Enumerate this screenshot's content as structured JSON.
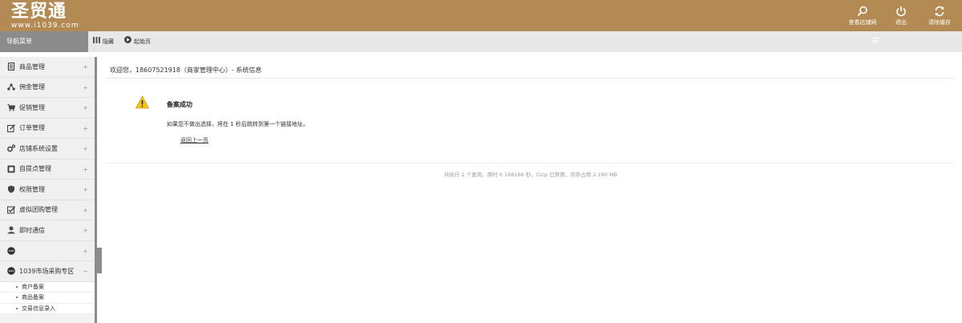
{
  "brand": {
    "name": "圣贸通",
    "url": "www.i1039.com"
  },
  "top_actions": [
    {
      "label": "查看店铺网",
      "icon": "search-icon"
    },
    {
      "label": "退出",
      "icon": "power-icon"
    },
    {
      "label": "清除缓存",
      "icon": "refresh-icon"
    }
  ],
  "subbar": {
    "nav_title": "导航菜单",
    "hide_label": "隐藏",
    "home_label": "起始页"
  },
  "sidebar": {
    "items": [
      {
        "label": "商品管理",
        "icon": "goods-icon",
        "toggle": "+"
      },
      {
        "label": "佣金管理",
        "icon": "share-icon",
        "toggle": "+"
      },
      {
        "label": "促销管理",
        "icon": "cart-icon",
        "toggle": "+"
      },
      {
        "label": "订单管理",
        "icon": "edit-order-icon",
        "toggle": "+"
      },
      {
        "label": "店铺系统设置",
        "icon": "cogs-icon",
        "toggle": "+"
      },
      {
        "label": "自提点管理",
        "icon": "pickup-icon",
        "toggle": "+"
      },
      {
        "label": "权限管理",
        "icon": "shield-icon",
        "toggle": "+"
      },
      {
        "label": "虚拟团购管理",
        "icon": "checkbox-icon",
        "toggle": "+"
      },
      {
        "label": "即时通信",
        "icon": "user-chat-icon",
        "toggle": "+"
      },
      {
        "label": "",
        "icon": "more-icon",
        "toggle": "+"
      },
      {
        "label": "1039市场采购专区",
        "icon": "more-icon",
        "toggle": "−"
      }
    ],
    "sub_items": [
      "商户备案",
      "商品备案",
      "交易信息录入"
    ]
  },
  "main": {
    "breadcrumb": "欢迎您，18607521918（商家管理中心）- 系统信息",
    "message_title": "备案成功",
    "message_text": "如果您不做出选择，将在 1 秒后跳转到第一个链接地址。",
    "back_link": "返回上一页",
    "footer": "共执行 2 个查询，用时 0.168166 秒，Gzip 已禁用，内存占用 2.180 MB"
  },
  "colors": {
    "header": "#b38a53",
    "nav_title": "#8c8c8c",
    "subbar": "#e8e8e8"
  }
}
